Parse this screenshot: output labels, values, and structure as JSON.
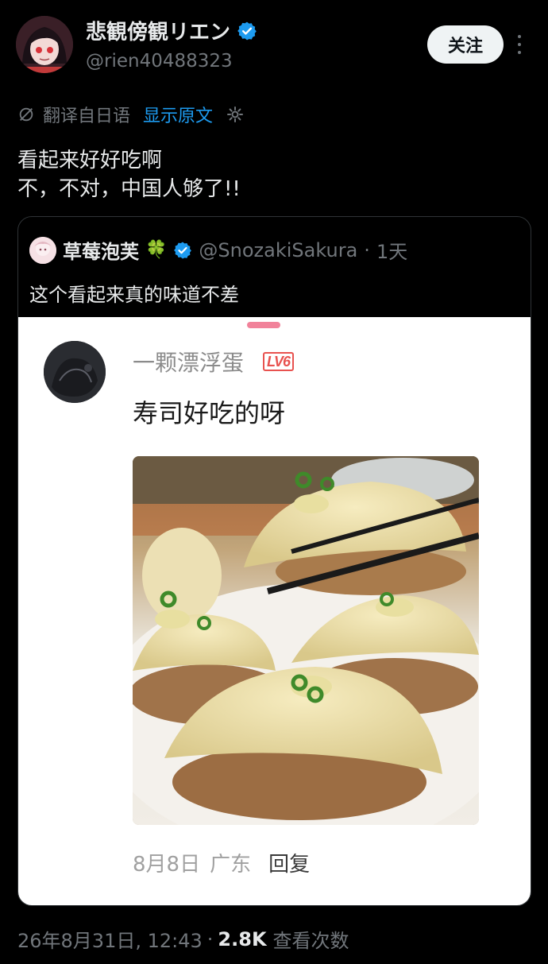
{
  "author": {
    "name": "悲観傍観リエン",
    "handle": "@rien40488323",
    "verified": true
  },
  "follow_label": "关注",
  "translation": {
    "label": "翻译自日语",
    "show_original": "显示原文"
  },
  "tweet_text": "看起来好好吃啊\n不，不对，中国人够了!!",
  "quote": {
    "name": "草莓泡芙",
    "clover": "🍀",
    "handle": "@SnozakiSakura",
    "separator": "·",
    "time": "1天",
    "text": "这个看起来真的味道不差",
    "screenshot": {
      "username": "一颗漂浮蛋",
      "level": "LV6",
      "text": "寿司好吃的呀",
      "date": "8月8日",
      "location": "广东",
      "reply": "回复"
    }
  },
  "footer": {
    "timestamp": "26年8月31日, 12:43",
    "dot": "·",
    "views": "2.8K",
    "views_label": "查看次数"
  },
  "colors": {
    "background": "#000000",
    "link": "#1d9bf0",
    "verified": "#1d9bf0",
    "muted": "#71767b"
  }
}
